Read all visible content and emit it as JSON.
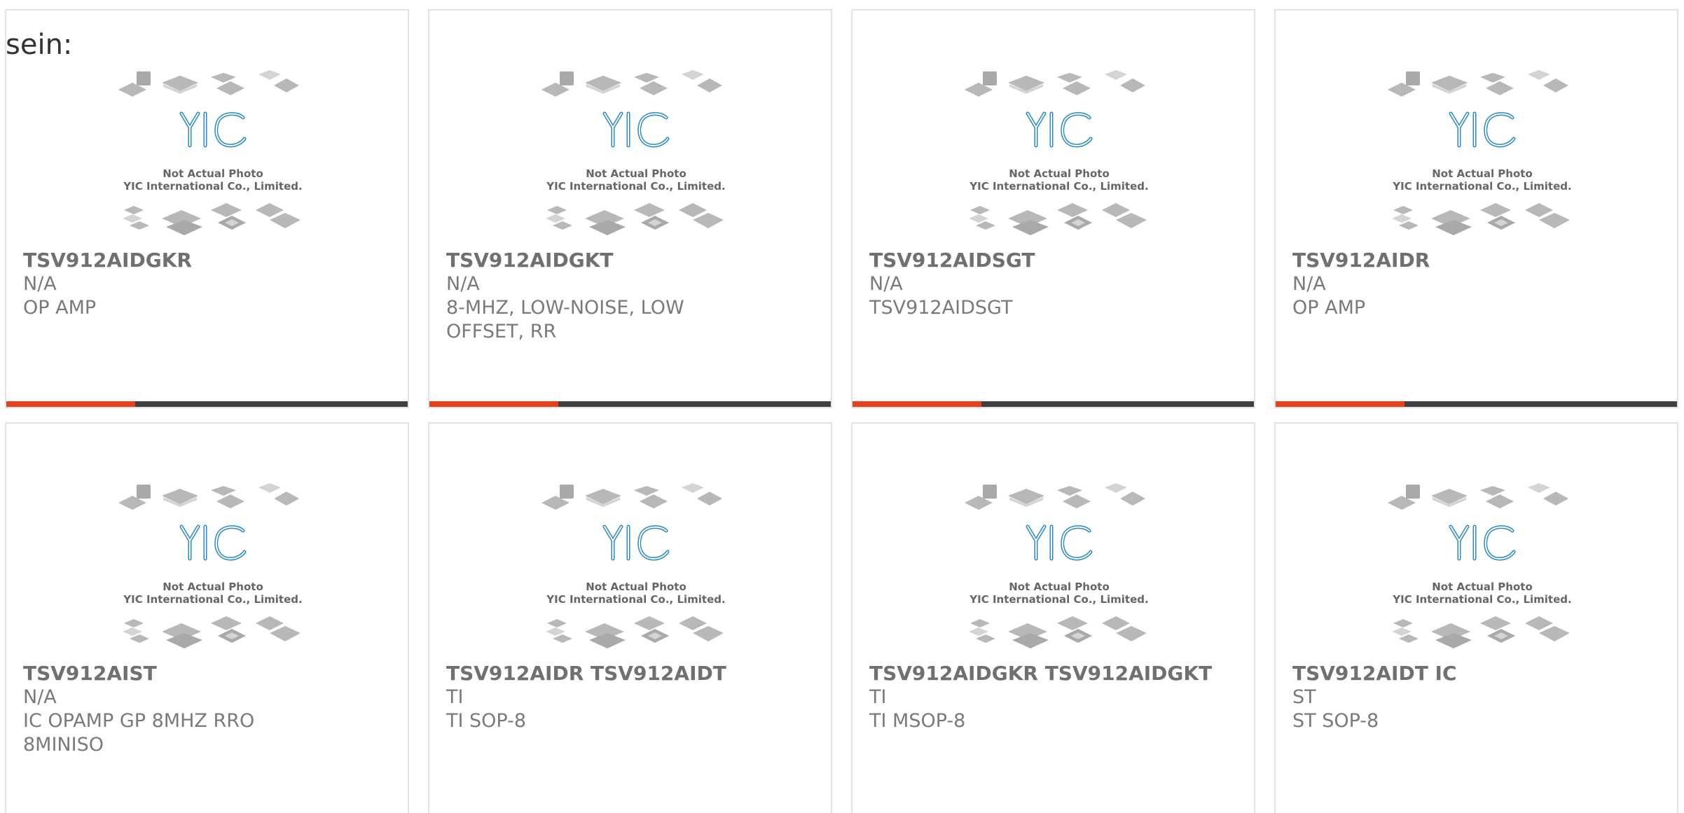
{
  "intro": "sein:",
  "accent_color": "#e8401c",
  "bar_color": "#404040",
  "photo": {
    "caption_line1": "Not Actual Photo",
    "caption_line2": "YIC International Co., Limited.",
    "logo_text": "YIC"
  },
  "products": [
    {
      "part": "TSV912AIDGKR",
      "mfr": "N/A",
      "desc": "OP AMP"
    },
    {
      "part": "TSV912AIDGKT",
      "mfr": "N/A",
      "desc": "8-MHZ, LOW-NOISE, LOW OFFSET, RR"
    },
    {
      "part": "TSV912AIDSGT",
      "mfr": "N/A",
      "desc": "TSV912AIDSGT"
    },
    {
      "part": "TSV912AIDR",
      "mfr": "N/A",
      "desc": "OP AMP"
    },
    {
      "part": "TSV912AIST",
      "mfr": "N/A",
      "desc": "IC OPAMP GP 8MHZ RRO 8MINISO"
    },
    {
      "part": "TSV912AIDR TSV912AIDT",
      "mfr": "TI",
      "desc": "TI SOP-8"
    },
    {
      "part": "TSV912AIDGKR TSV912AIDGKT",
      "mfr": "TI",
      "desc": "TI MSOP-8"
    },
    {
      "part": "TSV912AIDT IC",
      "mfr": "ST",
      "desc": "ST SOP-8"
    }
  ]
}
